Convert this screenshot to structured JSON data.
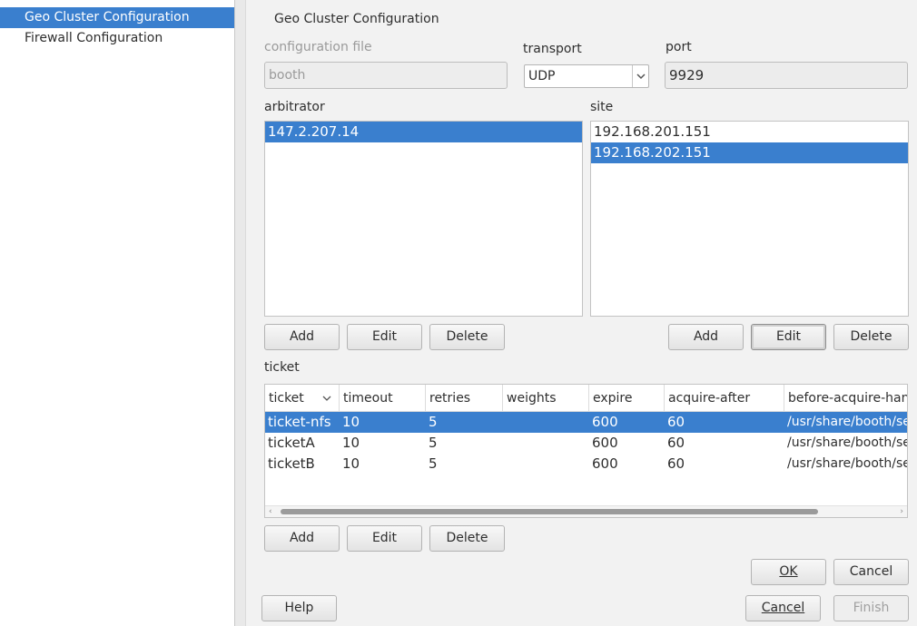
{
  "nav": {
    "items": [
      {
        "label": "Geo Cluster Configuration",
        "selected": true
      },
      {
        "label": "Firewall Configuration",
        "selected": false
      }
    ]
  },
  "page_title": "Geo Cluster Configuration",
  "config_file": {
    "label": "configuration file",
    "value": "booth"
  },
  "transport": {
    "label": "transport",
    "value": "UDP"
  },
  "port": {
    "label": "port",
    "value": "9929"
  },
  "arbitrator": {
    "label": "arbitrator",
    "items": [
      "147.2.207.14"
    ],
    "selected_index": 0
  },
  "site": {
    "label": "site",
    "items": [
      "192.168.201.151",
      "192.168.202.151"
    ],
    "selected_index": 1
  },
  "buttons": {
    "add": "Add",
    "edit": "Edit",
    "delete": "Delete",
    "ok": "OK",
    "cancel": "Cancel",
    "help": "Help",
    "finish": "Finish"
  },
  "ticket": {
    "label": "ticket",
    "columns": [
      "ticket",
      "timeout",
      "retries",
      "weights",
      "expire",
      "acquire-after",
      "before-acquire-handler"
    ],
    "rows": [
      {
        "ticket": "ticket-nfs",
        "timeout": "10",
        "retries": "5",
        "weights": "",
        "expire": "600",
        "acquire_after": "60",
        "handler": "/usr/share/booth/service-runnable",
        "selected": true
      },
      {
        "ticket": "ticketA",
        "timeout": "10",
        "retries": "5",
        "weights": "",
        "expire": "600",
        "acquire_after": "60",
        "handler": "/usr/share/booth/service-runnable",
        "selected": false
      },
      {
        "ticket": "ticketB",
        "timeout": "10",
        "retries": "5",
        "weights": "",
        "expire": "600",
        "acquire_after": "60",
        "handler": "/usr/share/booth/service-runnable",
        "selected": false
      }
    ]
  },
  "colors": {
    "selection": "#3a7fce",
    "background": "#f2f2f2"
  },
  "icons": {
    "dropdown": "chevron-down-icon",
    "sort": "sort-descending-icon",
    "scroll_left": "arrow-left-icon",
    "scroll_right": "arrow-right-icon"
  }
}
